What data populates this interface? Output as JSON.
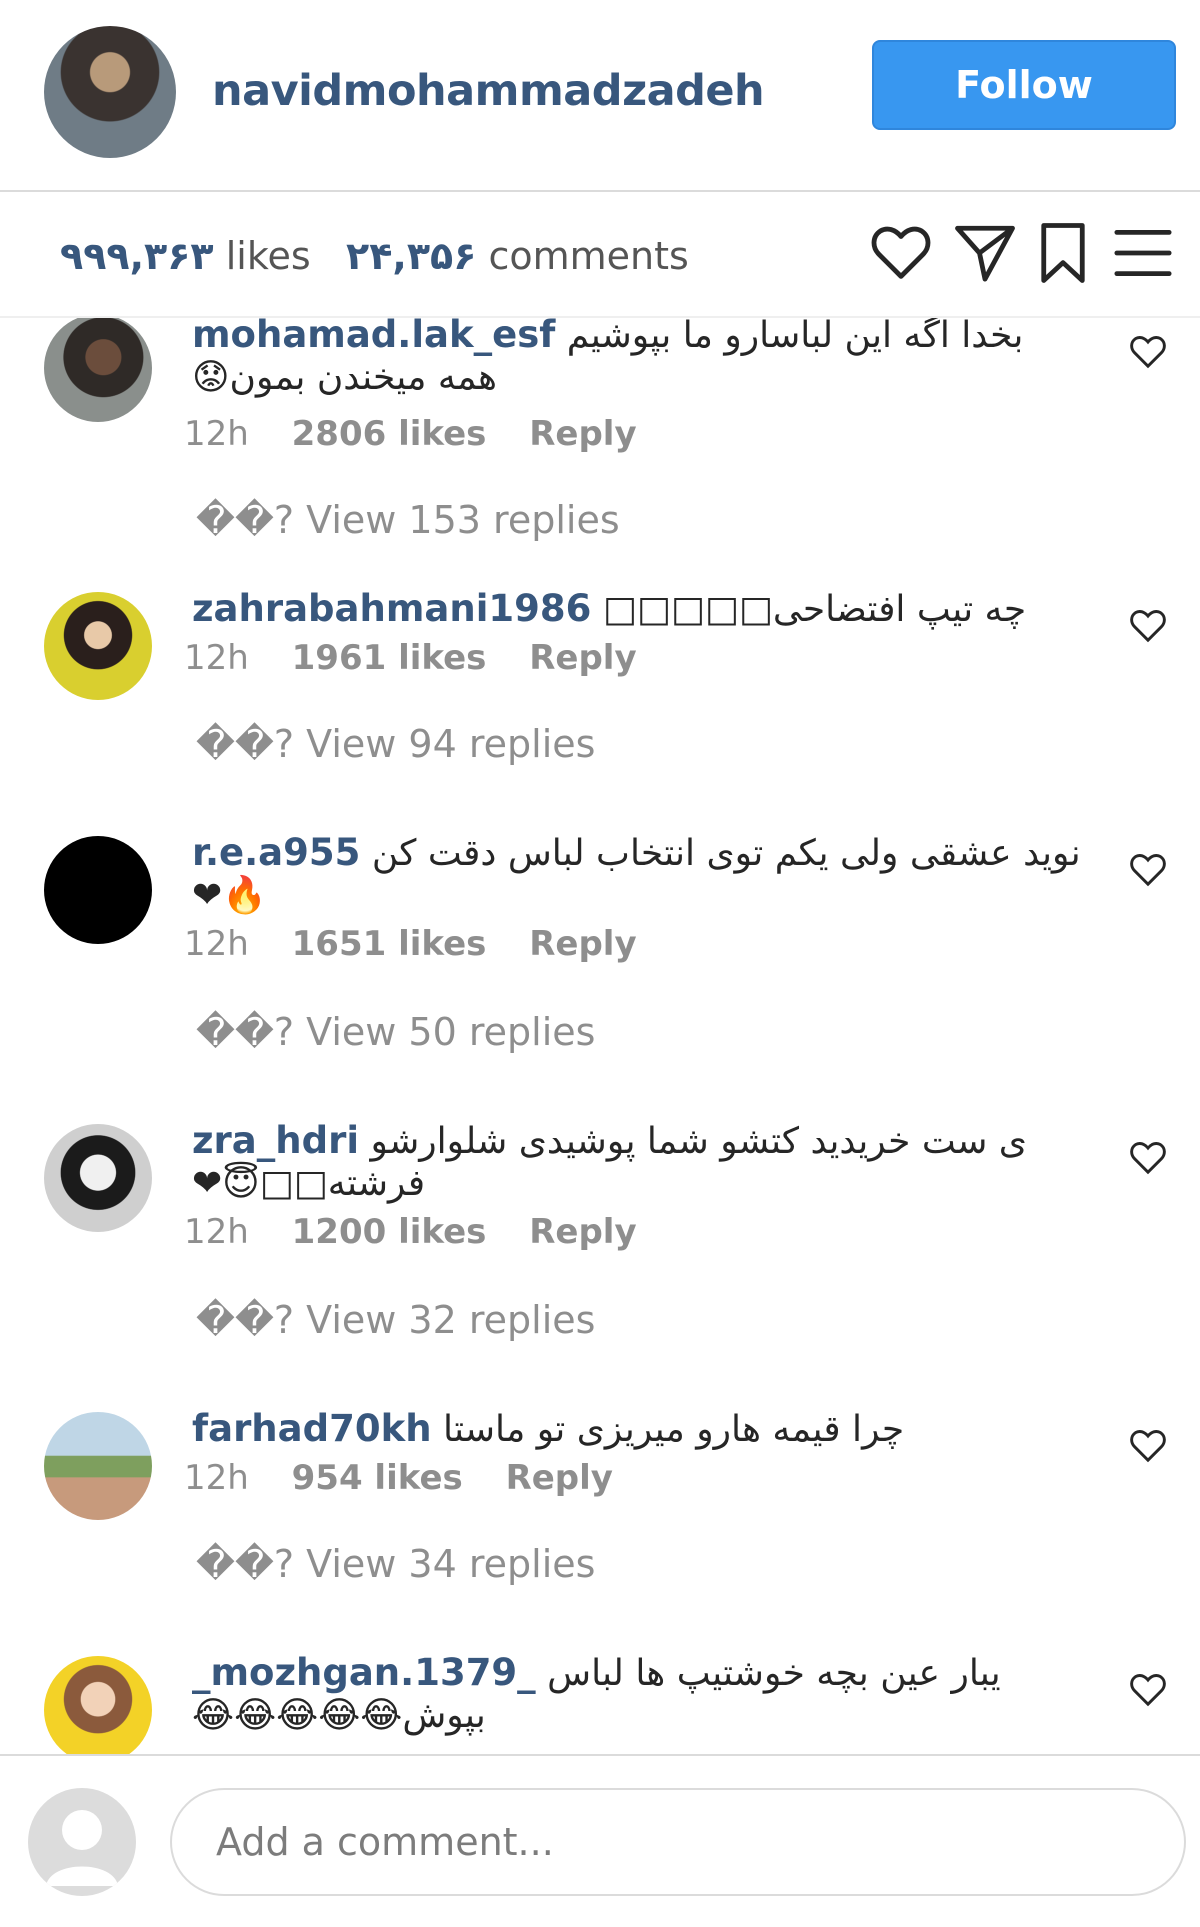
{
  "header": {
    "username": "navidmohammadzadeh",
    "follow_label": "Follow",
    "follow_color": "#3897f0",
    "username_color": "#38577d"
  },
  "stats": {
    "likes_count": "۹۹۹,۳۶۳",
    "likes_label": "likes",
    "comments_count": "۲۴,۳۵۶",
    "comments_label": "comments"
  },
  "actions": [
    "heart-icon",
    "send-icon",
    "bookmark-icon",
    "menu-icon"
  ],
  "comments": [
    {
      "username": "mohamad.lak_esf",
      "text": "بخدا اگه این لباسارو ما بپوشیم همه میخندن بمون😟",
      "time": "12h",
      "likes": "2806 likes",
      "reply": "Reply",
      "view_replies": "��? View 153 replies"
    },
    {
      "username": "zahrabahmani1986",
      "text": "چه تیپ افتضاحی□□□□□",
      "time": "12h",
      "likes": "1961 likes",
      "reply": "Reply",
      "view_replies": "��? View 94 replies"
    },
    {
      "username": "r.e.a955",
      "text": "نوید عشقی ولی یکم توی انتخاب لباس دقت کن🔥❤",
      "time": "12h",
      "likes": "1651 likes",
      "reply": "Reply",
      "view_replies": "��? View 50 replies"
    },
    {
      "username": "zra_hdri",
      "text": "ی ست خریدید کتشو شما پوشیدی شلوارشو فرشته□□😇❤",
      "time": "12h",
      "likes": "1200 likes",
      "reply": "Reply",
      "view_replies": "��? View 32 replies"
    },
    {
      "username": "farhad70kh",
      "text": "چرا قیمه هارو میریزی تو ماستا",
      "time": "12h",
      "likes": "954 likes",
      "reply": "Reply",
      "view_replies": "��? View 34 replies"
    },
    {
      "username": "_mozhgan.1379_",
      "text": "یبار عین بچه خوشتیپ ها لباس بپوش😂😂😂😂😂",
      "time": "",
      "likes": "",
      "reply": "",
      "view_replies": ""
    }
  ],
  "composer": {
    "placeholder": "Add a comment..."
  }
}
